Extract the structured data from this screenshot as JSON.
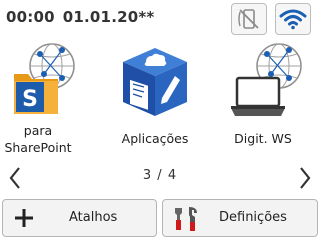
{
  "status": {
    "time": "00:00",
    "date": "01.01.20**"
  },
  "status_icons": [
    "nfc-disabled-icon",
    "wifi-icon"
  ],
  "apps": [
    {
      "label_line1": "para",
      "label_line2": "SharePoint",
      "icon": "sharepoint-globe-icon"
    },
    {
      "label": "Aplicações",
      "icon": "applications-cube-icon"
    },
    {
      "label": "Digit. WS",
      "icon": "scan-ws-globe-icon"
    }
  ],
  "pager": {
    "text": "3 / 4"
  },
  "bottom": {
    "shortcuts_label": "Atalhos",
    "settings_label": "Definições"
  },
  "colors": {
    "accent_blue": "#1a5fb4",
    "sharepoint_orange": "#f0a21f",
    "cube_blue": "#1f4fa6",
    "settings_red": "#d01a1a"
  }
}
